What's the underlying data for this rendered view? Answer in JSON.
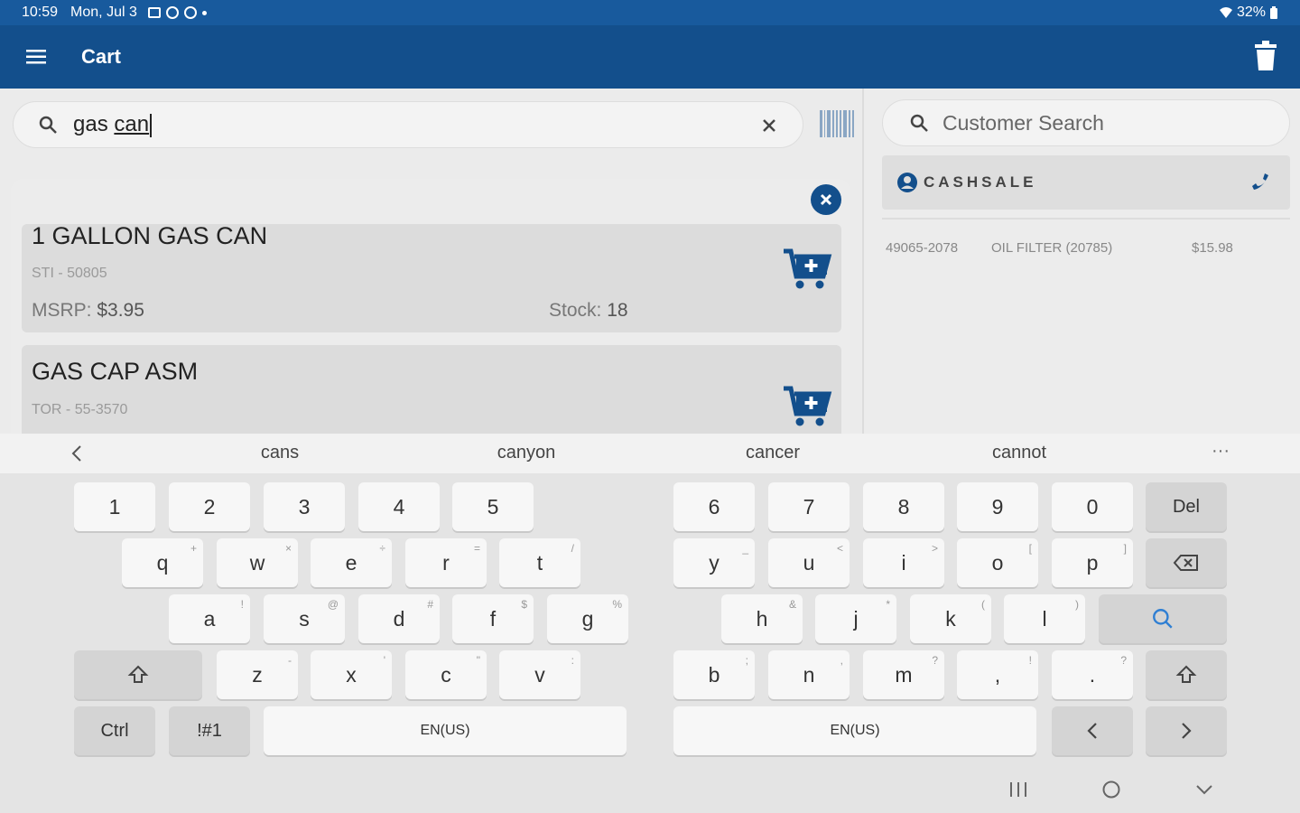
{
  "status_bar": {
    "time": "10:59",
    "date": "Mon, Jul 3",
    "battery": "32%"
  },
  "app_bar": {
    "title": "Cart",
    "menu_icon": "hamburger-menu-icon",
    "delete_icon": "trash-icon"
  },
  "product_search": {
    "value_prefix": "gas ",
    "value_underlined": "can",
    "search_icon": "search-icon",
    "clear_icon": "close-icon",
    "barcode_icon": "barcode-icon"
  },
  "results": [
    {
      "name": "1 GALLON GAS CAN",
      "code": "STI - 50805",
      "msrp_label": "MSRP:",
      "msrp_value": "$3.95",
      "stock_label": "Stock:",
      "stock_value": "18"
    },
    {
      "name": "GAS CAP ASM",
      "code": "TOR - 55-3570"
    }
  ],
  "customer": {
    "search_placeholder": "Customer Search",
    "name": "CASHSALE"
  },
  "cart_lines": [
    {
      "part": "49065-2078",
      "description": "OIL FILTER (20785)",
      "price": "$15.98"
    }
  ],
  "keyboard": {
    "suggestions": [
      "cans",
      "canyon",
      "cancer",
      "cannot"
    ],
    "more": "···",
    "row1_left": [
      "1",
      "2",
      "3",
      "4",
      "5"
    ],
    "row1_right": [
      "6",
      "7",
      "8",
      "9",
      "0"
    ],
    "del_label": "Del",
    "row2_left": [
      {
        "key": "q",
        "alt": "+"
      },
      {
        "key": "w",
        "alt": "×"
      },
      {
        "key": "e",
        "alt": "÷"
      },
      {
        "key": "r",
        "alt": "="
      },
      {
        "key": "t",
        "alt": "/"
      }
    ],
    "row2_right": [
      {
        "key": "y",
        "alt": "_"
      },
      {
        "key": "u",
        "alt": "<"
      },
      {
        "key": "i",
        "alt": ">"
      },
      {
        "key": "o",
        "alt": "["
      },
      {
        "key": "p",
        "alt": "]"
      }
    ],
    "row3_left": [
      {
        "key": "a",
        "alt": "!"
      },
      {
        "key": "s",
        "alt": "@"
      },
      {
        "key": "d",
        "alt": "#"
      },
      {
        "key": "f",
        "alt": "$"
      },
      {
        "key": "g",
        "alt": "%"
      }
    ],
    "row3_right": [
      {
        "key": "h",
        "alt": "&"
      },
      {
        "key": "j",
        "alt": "*"
      },
      {
        "key": "k",
        "alt": "("
      },
      {
        "key": "l",
        "alt": ")"
      }
    ],
    "row4_left": [
      {
        "key": "z",
        "alt": "-"
      },
      {
        "key": "x",
        "alt": "'"
      },
      {
        "key": "c",
        "alt": "\""
      },
      {
        "key": "v",
        "alt": ":"
      }
    ],
    "row4_right": [
      {
        "key": "b",
        "alt": ";"
      },
      {
        "key": "n",
        "alt": ","
      },
      {
        "key": "m",
        "alt": "?"
      },
      {
        "key": ",",
        "alt": "!"
      },
      {
        "key": ".",
        "alt": "?"
      }
    ],
    "ctrl_label": "Ctrl",
    "symbols_label": "!#1",
    "space_label_left": "EN(US)",
    "space_label_right": "EN(US)"
  }
}
